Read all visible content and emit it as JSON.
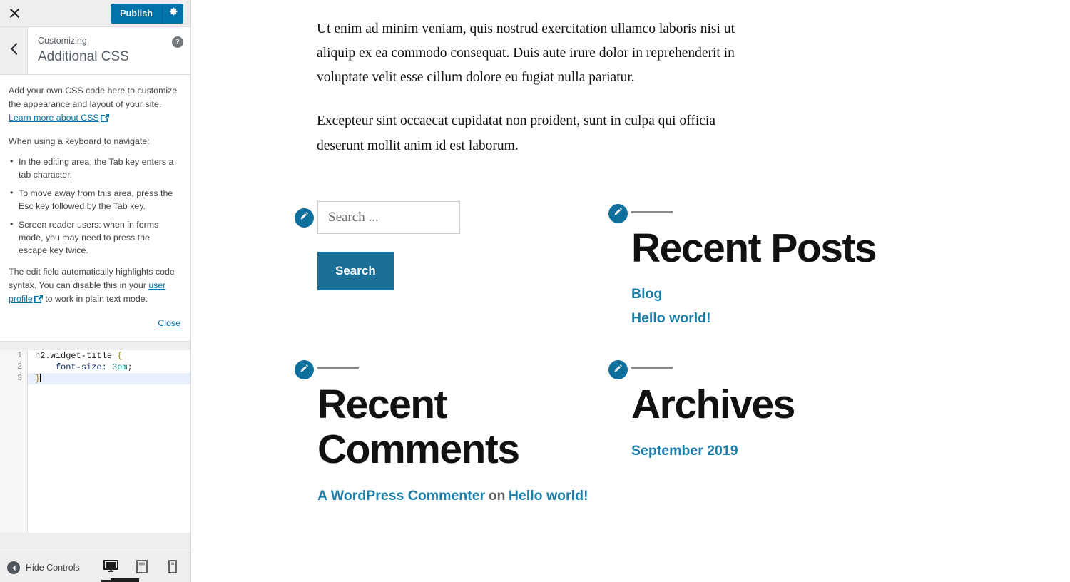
{
  "customizer": {
    "close_label": "Close customizer",
    "publish_label": "Publish",
    "settings_label": "Publish settings",
    "kicker": "Customizing",
    "title": "Additional CSS",
    "help_label": "Help",
    "accent_color": "#0073aa"
  },
  "help": {
    "intro": "Add your own CSS code here to customize the appearance and layout of your site.",
    "learn_more": "Learn more about CSS",
    "keyboard_heading": "When using a keyboard to navigate:",
    "bullets": [
      "In the editing area, the Tab key enters a tab character.",
      "To move away from this area, press the Esc key followed by the Tab key.",
      "Screen reader users: when in forms mode, you may need to press the escape key twice."
    ],
    "syntax_note_before": "The edit field automatically highlights code syntax. You can disable this in your ",
    "syntax_note_link": "user profile",
    "syntax_note_after": " to work in plain text mode.",
    "close_label": "Close"
  },
  "editor": {
    "lines": [
      {
        "num": "1",
        "selector": "h2.widget-title",
        "brace": "{"
      },
      {
        "num": "2",
        "property": "font-size:",
        "value": "3em",
        "semi": ";"
      },
      {
        "num": "3",
        "closebrace": "}"
      }
    ],
    "line_numbers": [
      "1",
      "2",
      "3"
    ],
    "code_text": "h2.widget-title {\n    font-size: 3em;\n}",
    "active_line": "3"
  },
  "bottom_bar": {
    "hide_controls_label": "Hide Controls",
    "devices": [
      {
        "name": "desktop",
        "label": "Desktop",
        "active": true
      },
      {
        "name": "tablet",
        "label": "Tablet",
        "active": false
      },
      {
        "name": "mobile",
        "label": "Mobile",
        "active": false
      }
    ]
  },
  "preview": {
    "paragraphs": [
      "Ut enim ad minim veniam, quis nostrud exercitation ullamco laboris nisi ut aliquip ex ea commodo consequat. Duis aute irure dolor in reprehenderit in voluptate velit esse cillum dolore eu fugiat nulla pariatur.",
      "Excepteur sint occaecat cupidatat non proident, sunt in culpa qui officia deserunt mollit anim id est laborum."
    ],
    "search_widget": {
      "placeholder": "Search ...",
      "value": "",
      "button_label": "Search",
      "edit_label": "Edit Search widget"
    },
    "widgets": [
      {
        "id": "recent-posts",
        "title": "Recent Posts",
        "edit_label": "Edit Recent Posts widget",
        "links": [
          "Blog",
          "Hello world!"
        ]
      },
      {
        "id": "recent-comments",
        "title": "Recent Comments",
        "edit_label": "Edit Recent Comments widget",
        "comment_author": "A WordPress Commenter",
        "comment_on": "on",
        "comment_post": "Hello world!"
      },
      {
        "id": "archives",
        "title": "Archives",
        "edit_label": "Edit Archives widget",
        "links": [
          "September 2019"
        ]
      }
    ],
    "link_color": "#1b7ea8"
  }
}
